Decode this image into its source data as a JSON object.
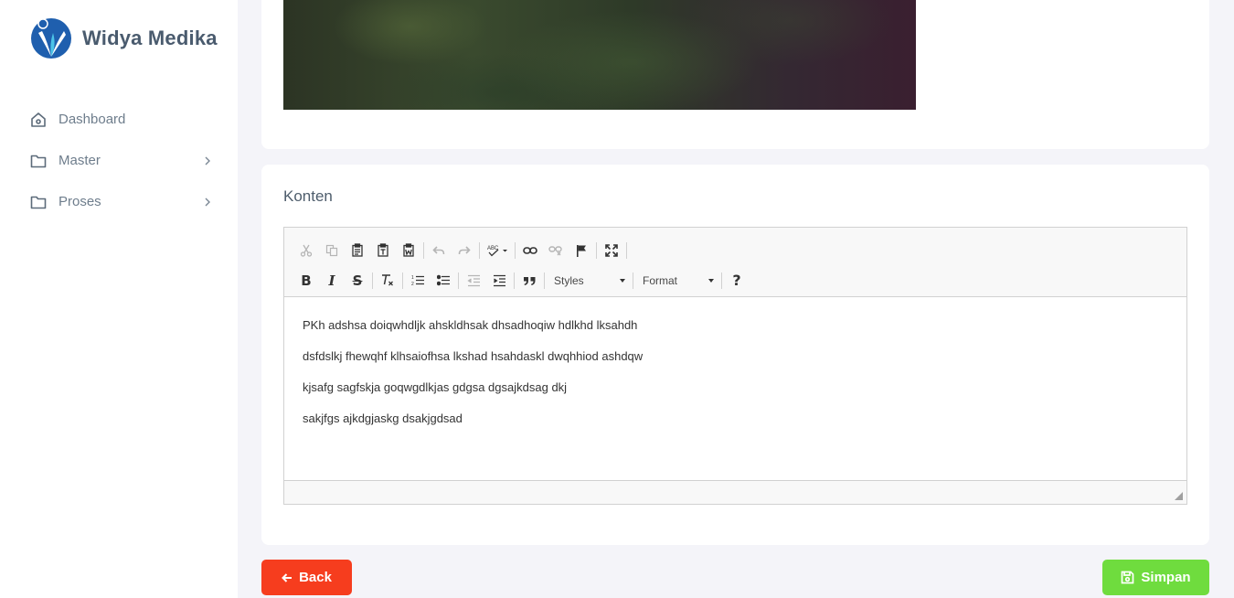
{
  "brand": {
    "name": "Widya Medika",
    "colors": {
      "primary": "#1f5fae",
      "accent": "#4cc4e8"
    }
  },
  "sidebar": {
    "items": [
      {
        "label": "Dashboard",
        "icon": "home-icon",
        "has_submenu": false
      },
      {
        "label": "Master",
        "icon": "folder-icon",
        "has_submenu": true
      },
      {
        "label": "Proses",
        "icon": "folder-icon",
        "has_submenu": true
      }
    ]
  },
  "konten": {
    "title": "Konten",
    "editor": {
      "toolbar": {
        "styles_label": "Styles",
        "format_label": "Format",
        "help_label": "?"
      },
      "paragraphs": [
        "PKh adshsa doiqwhdljk ahskldhsak dhsadhoqiw hdlkhd lksahdh",
        "dsfdslkj fhewqhf klhsaiofhsa lkshad hsahdaskl dwqhhiod ashdqw",
        "kjsafg sagfskja goqwgdlkjas gdgsa dgsajkdsag dkj",
        "sakjfgs ajkdgjaskg dsakjgdsad"
      ]
    }
  },
  "actions": {
    "back_label": "Back",
    "save_label": "Simpan",
    "back_color": "#f63d1e",
    "save_color": "#6fdc3e"
  }
}
